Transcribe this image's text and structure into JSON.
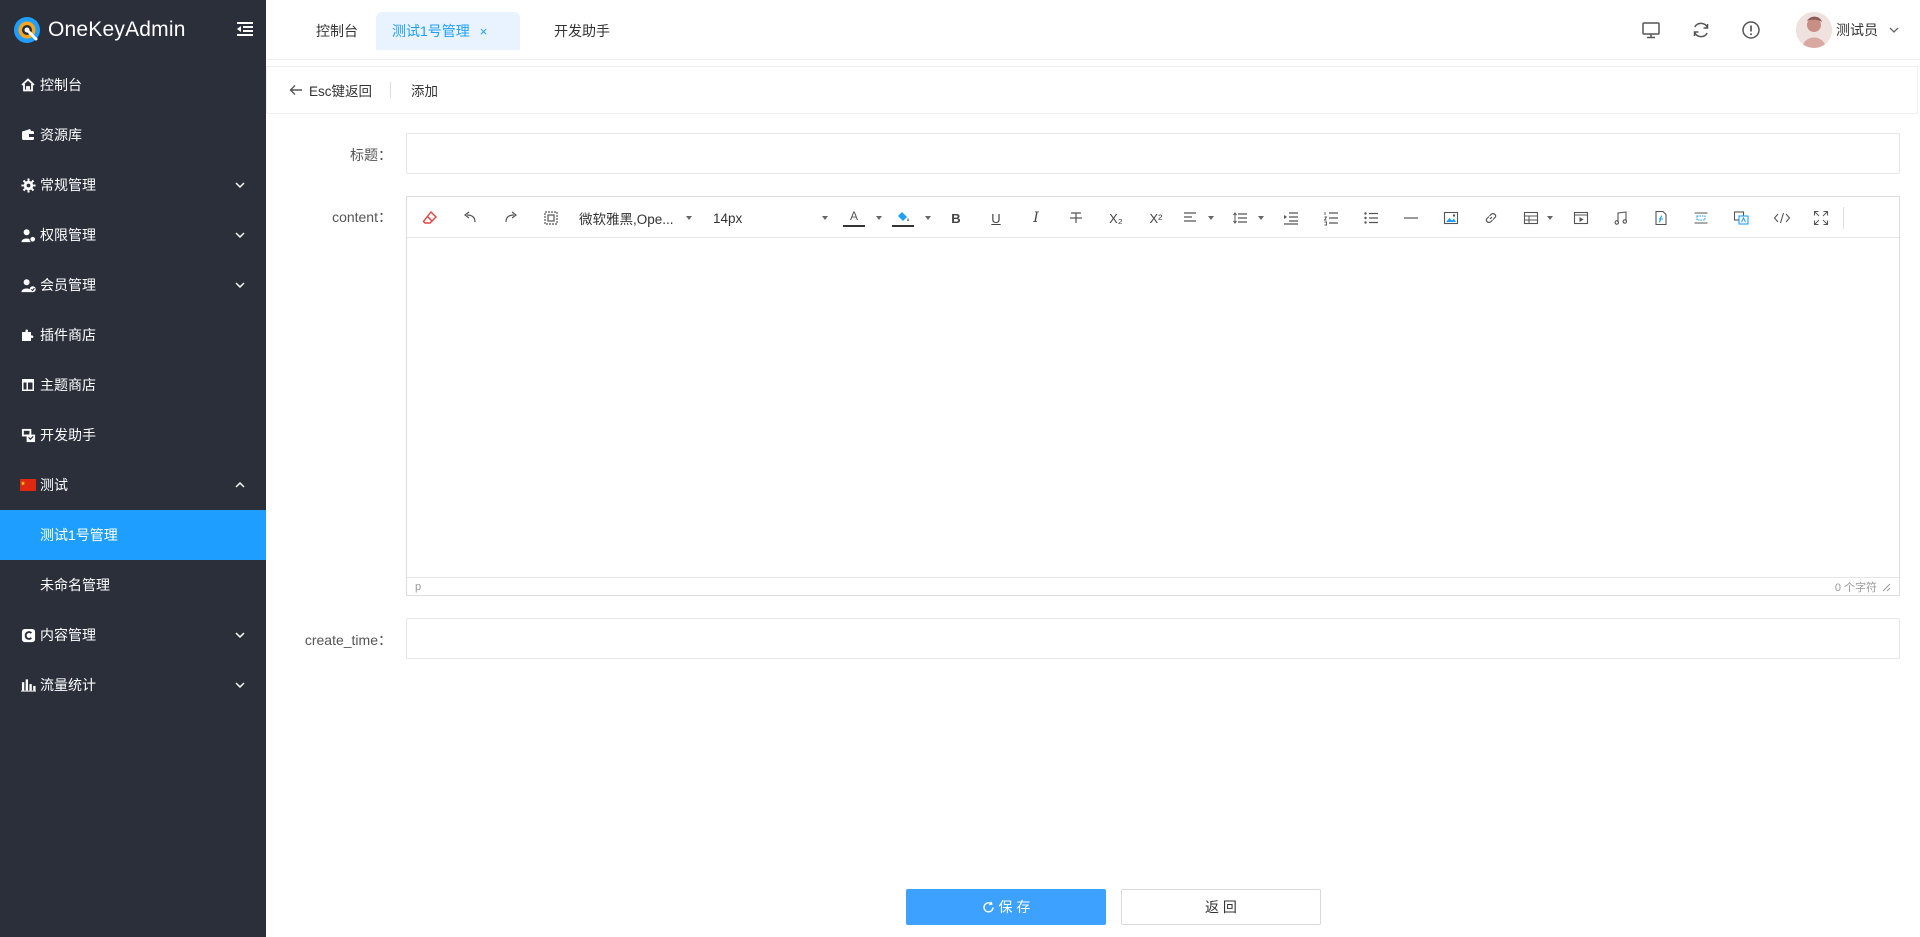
{
  "app": {
    "brand": "OneKeyAdmin"
  },
  "sidebar": {
    "items": [
      {
        "label": "控制台",
        "icon": "home-icon"
      },
      {
        "label": "资源库",
        "icon": "wallet-icon"
      },
      {
        "label": "常规管理",
        "icon": "gear-icon",
        "expandable": true
      },
      {
        "label": "权限管理",
        "icon": "user-shield-icon",
        "expandable": true
      },
      {
        "label": "会员管理",
        "icon": "user-check-icon",
        "expandable": true
      },
      {
        "label": "插件商店",
        "icon": "puzzle-icon"
      },
      {
        "label": "主题商店",
        "icon": "layout-icon"
      },
      {
        "label": "开发助手",
        "icon": "dev-tools-icon"
      },
      {
        "label": "测试",
        "icon": "flag-cn-icon",
        "expanded": true
      },
      {
        "label": "测试1号管理",
        "active": true
      },
      {
        "label": "未命名管理"
      },
      {
        "label": "内容管理",
        "icon": "copyright-icon",
        "expandable": true
      },
      {
        "label": "流量统计",
        "icon": "bar-chart-icon",
        "expandable": true
      }
    ]
  },
  "tabs": [
    {
      "label": "控制台"
    },
    {
      "label": "测试1号管理",
      "active": true,
      "close": "×"
    },
    {
      "label": "开发助手"
    }
  ],
  "topbar": {
    "icons": [
      "monitor-icon",
      "refresh-icon",
      "info-icon"
    ],
    "user_name": "测试员"
  },
  "header": {
    "back_label": "Esc键返回",
    "page_title": "添加"
  },
  "form": {
    "title_label": "标题：",
    "title_value": "",
    "content_label": "content：",
    "create_time_label": "create_time：",
    "create_time_value": ""
  },
  "editor": {
    "font_family": "微软雅黑,Ope...",
    "font_size": "14px",
    "text_color_glyph": "A",
    "bold": "B",
    "underline": "U",
    "italic": "I",
    "subscript": "X₂",
    "superscript": "X²",
    "status_path": "p",
    "char_count": "0 个字符",
    "colors": {
      "text_underline": "#333333",
      "bg_underline": "#333333"
    }
  },
  "buttons": {
    "save": "保 存",
    "back": "返 回"
  },
  "colors": {
    "sidebar_bg": "#2a2f3a",
    "accent": "#1e9fff",
    "save_button": "#3da2ff"
  }
}
